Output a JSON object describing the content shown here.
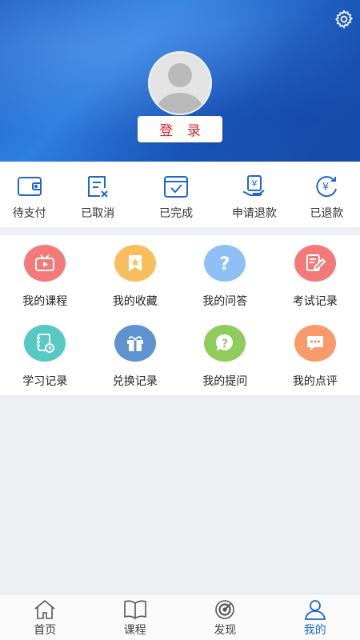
{
  "header": {
    "login_label": "登 录",
    "settings_icon": "gear-icon"
  },
  "orders": [
    {
      "label": "待支付",
      "icon": "wallet-icon"
    },
    {
      "label": "已取消",
      "icon": "cancelled-doc-icon"
    },
    {
      "label": "已完成",
      "icon": "completed-check-icon"
    },
    {
      "label": "申请退款",
      "icon": "refund-request-icon"
    },
    {
      "label": "已退款",
      "icon": "refunded-icon"
    }
  ],
  "grid": [
    {
      "label": "我的课程",
      "icon": "play-tv-icon",
      "color": "#f47a7a"
    },
    {
      "label": "我的收藏",
      "icon": "bookmark-star-icon",
      "color": "#f9bf5e"
    },
    {
      "label": "我的问答",
      "icon": "question-icon",
      "color": "#8ec0f6"
    },
    {
      "label": "考试记录",
      "icon": "exam-pen-icon",
      "color": "#f47a7a"
    },
    {
      "label": "学习记录",
      "icon": "study-clock-icon",
      "color": "#56c9c4"
    },
    {
      "label": "兑换记录",
      "icon": "gift-icon",
      "color": "#5f93cf"
    },
    {
      "label": "我的提问",
      "icon": "question-bubble-icon",
      "color": "#8fcc5c"
    },
    {
      "label": "我的点评",
      "icon": "comment-icon",
      "color": "#f99a6a"
    }
  ],
  "tabs": [
    {
      "label": "首页",
      "icon": "home-icon",
      "active": false
    },
    {
      "label": "课程",
      "icon": "book-icon",
      "active": false
    },
    {
      "label": "发现",
      "icon": "discover-icon",
      "active": false
    },
    {
      "label": "我的",
      "icon": "user-icon",
      "active": true
    }
  ],
  "colors": {
    "accent": "#1f66cc",
    "login_text": "#d9232d"
  }
}
